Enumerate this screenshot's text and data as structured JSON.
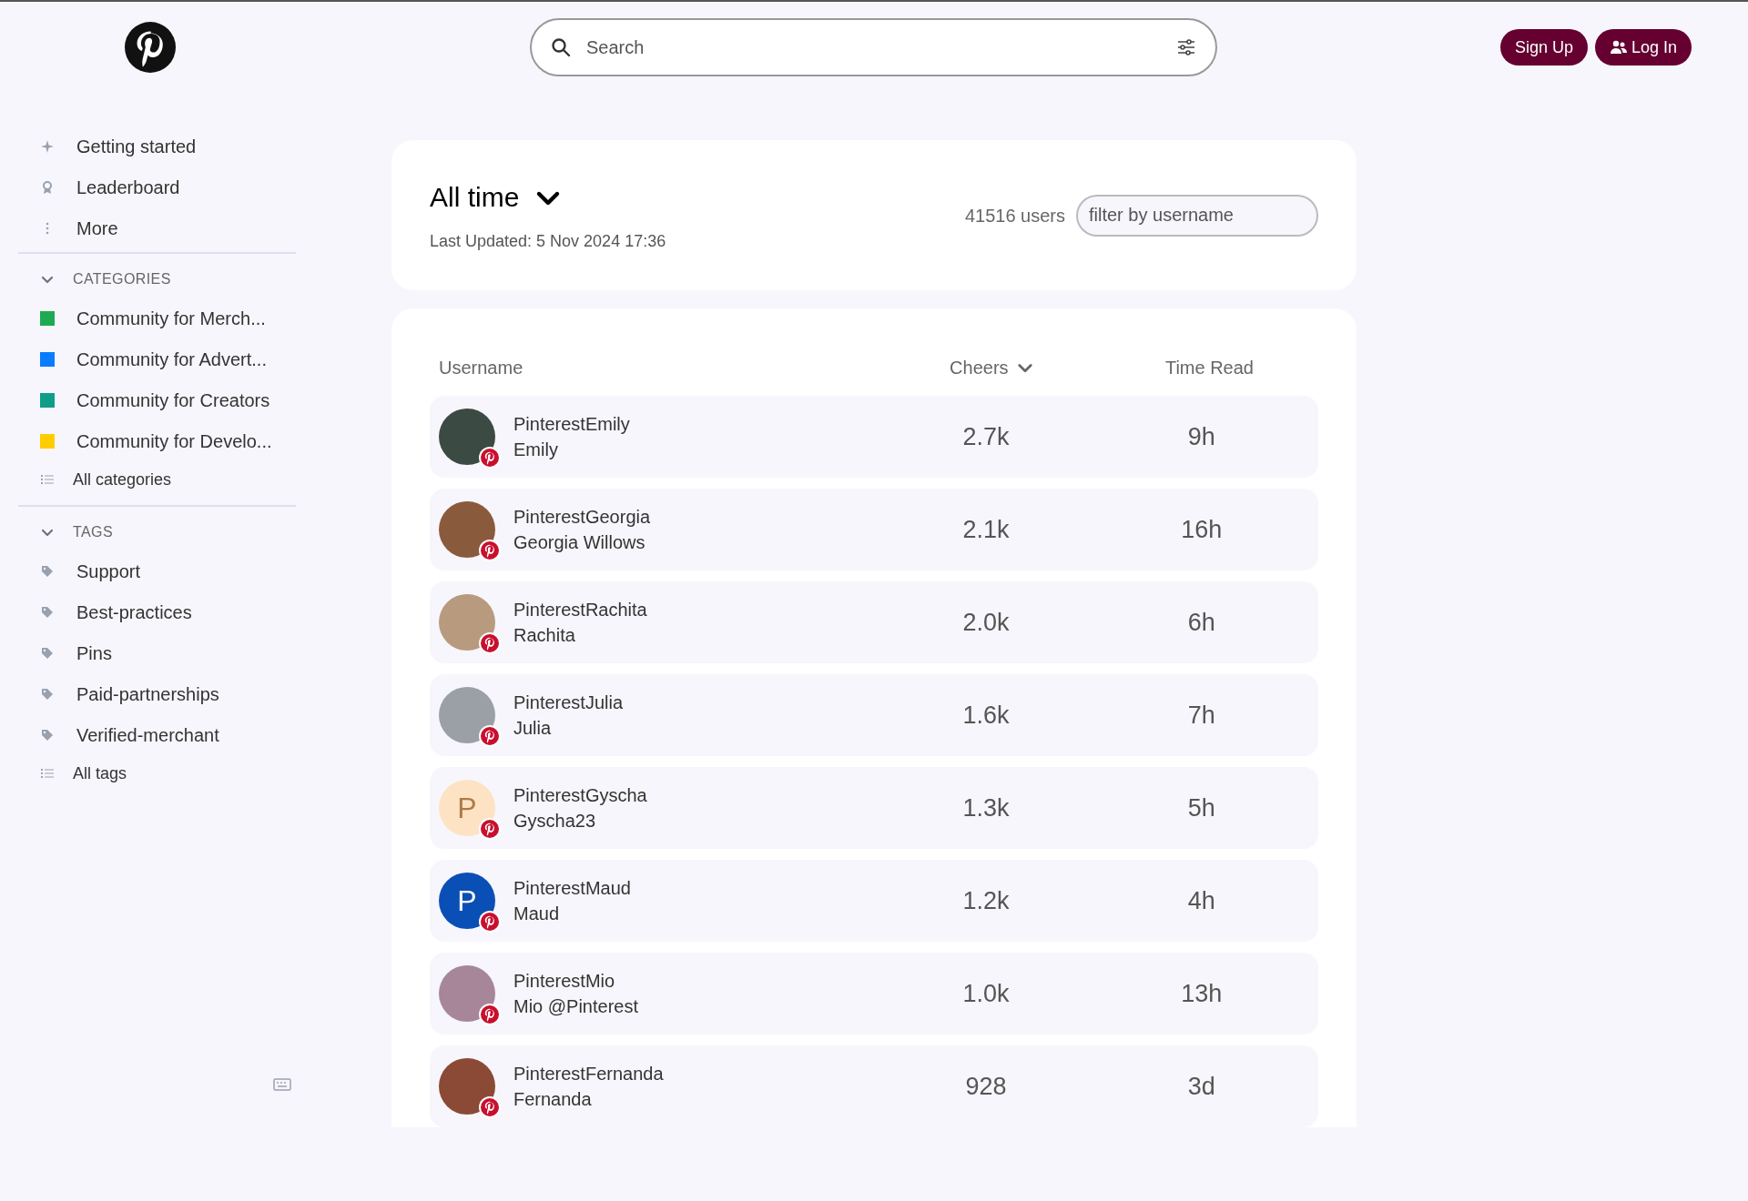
{
  "header": {
    "search": {
      "placeholder": "Search"
    },
    "buttons": [
      {
        "label": "Sign Up",
        "kind": "plain"
      },
      {
        "label": "Log In",
        "kind": "user"
      }
    ]
  },
  "sidebar": {
    "items": [
      {
        "label": "Getting started",
        "kind": "sparkle"
      },
      {
        "label": "Leaderboard",
        "kind": "award"
      },
      {
        "label": "More",
        "kind": "dots"
      }
    ],
    "sections": [
      {
        "title": "CATEGORIES",
        "expanded": true,
        "items": [
          {
            "label": "Community for Merch...",
            "color": "#1fa954"
          },
          {
            "label": "Community for Advert...",
            "color": "#0a7cff"
          },
          {
            "label": "Community for Creators",
            "color": "#0f9d8a"
          },
          {
            "label": "Community for Develo...",
            "color": "#ffcc00"
          }
        ],
        "all": "All categories"
      },
      {
        "title": "TAGS",
        "expanded": true,
        "items": [
          {
            "label": "Support"
          },
          {
            "label": "Best-practices"
          },
          {
            "label": "Pins"
          },
          {
            "label": "Paid-partnerships"
          },
          {
            "label": "Verified-merchant"
          }
        ],
        "all": "All tags"
      }
    ]
  },
  "period": {
    "title": "All time",
    "updated": "Last Updated: 5 Nov 2024 17:36",
    "users": "41516 users",
    "filter_placeholder": "filter by username"
  },
  "table": {
    "columns": [
      "Username",
      "Cheers",
      "Time Read"
    ],
    "rows": [
      {
        "username": "PinterestEmily",
        "name": "Emily",
        "cheers": "2.7k",
        "time": "9h",
        "avatar": {
          "kind": "photo",
          "color": "#3b4a42"
        }
      },
      {
        "username": "PinterestGeorgia",
        "name": "Georgia Willows",
        "cheers": "2.1k",
        "time": "16h",
        "avatar": {
          "kind": "photo",
          "color": "#8a5a3c"
        }
      },
      {
        "username": "PinterestRachita",
        "name": "Rachita",
        "cheers": "2.0k",
        "time": "6h",
        "avatar": {
          "kind": "photo",
          "color": "#b89a7e"
        }
      },
      {
        "username": "PinterestJulia",
        "name": "Julia",
        "cheers": "1.6k",
        "time": "7h",
        "avatar": {
          "kind": "photo",
          "color": "#9aa0a6"
        }
      },
      {
        "username": "PinterestGyscha",
        "name": "Gyscha23",
        "cheers": "1.3k",
        "time": "5h",
        "avatar": {
          "kind": "letter",
          "letter": "P",
          "color": "#fde3c4"
        }
      },
      {
        "username": "PinterestMaud",
        "name": "Maud",
        "cheers": "1.2k",
        "time": "4h",
        "avatar": {
          "kind": "letter",
          "letter": "P",
          "color": "#0a4fb5"
        }
      },
      {
        "username": "PinterestMio",
        "name": "Mio @Pinterest",
        "cheers": "1.0k",
        "time": "13h",
        "avatar": {
          "kind": "photo",
          "color": "#a7869a"
        }
      },
      {
        "username": "PinterestFernanda",
        "name": "Fernanda",
        "cheers": "928",
        "time": "3d",
        "avatar": {
          "kind": "photo",
          "color": "#8b4a35"
        }
      }
    ]
  }
}
